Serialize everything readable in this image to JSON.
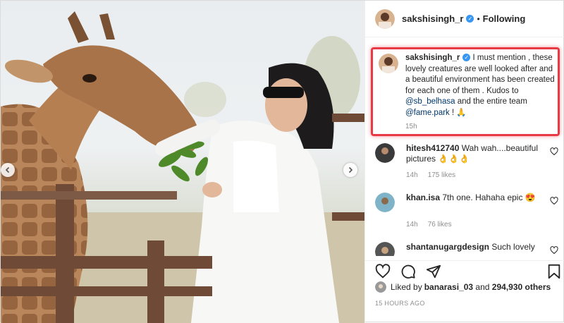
{
  "post": {
    "username": "sakshisingh_r",
    "verified_glyph": "✓",
    "separator": "•",
    "following_label": "Following"
  },
  "caption": {
    "username": "sakshisingh_r",
    "text_part1": " I must mention , these lovely creatures are well looked after and a beautiful environment has been created for each one of them . Kudos to ",
    "mention1": "@sb_belhasa",
    "text_part2": " and the entire team ",
    "mention2": "@fame.park",
    "text_part3": " ! 🙏",
    "time": "15h"
  },
  "comments": [
    {
      "username": "hitesh412740",
      "text": "Wah wah....beautiful pictures 👌👌👌",
      "time": "14h",
      "likes": "175 likes"
    },
    {
      "username": "khan.isa",
      "text": "7th one. Hahaha epic 😍",
      "time": "14h",
      "likes": "76 likes"
    },
    {
      "username": "shantanugargdesign",
      "text": "Such lovely"
    }
  ],
  "likes_line": {
    "prefix": "Liked by ",
    "user": "banarasi_03",
    "middle": " and ",
    "count": "294,930 others"
  },
  "timestamp": "15 HOURS AGO",
  "icons": {
    "like": "heart-icon",
    "comment": "comment-icon",
    "share": "share-icon",
    "save": "bookmark-icon",
    "prev": "chevron-left-icon",
    "next": "chevron-right-icon"
  },
  "colors": {
    "highlight": "#e83a44",
    "verified": "#3897f0",
    "link": "#00376b"
  }
}
